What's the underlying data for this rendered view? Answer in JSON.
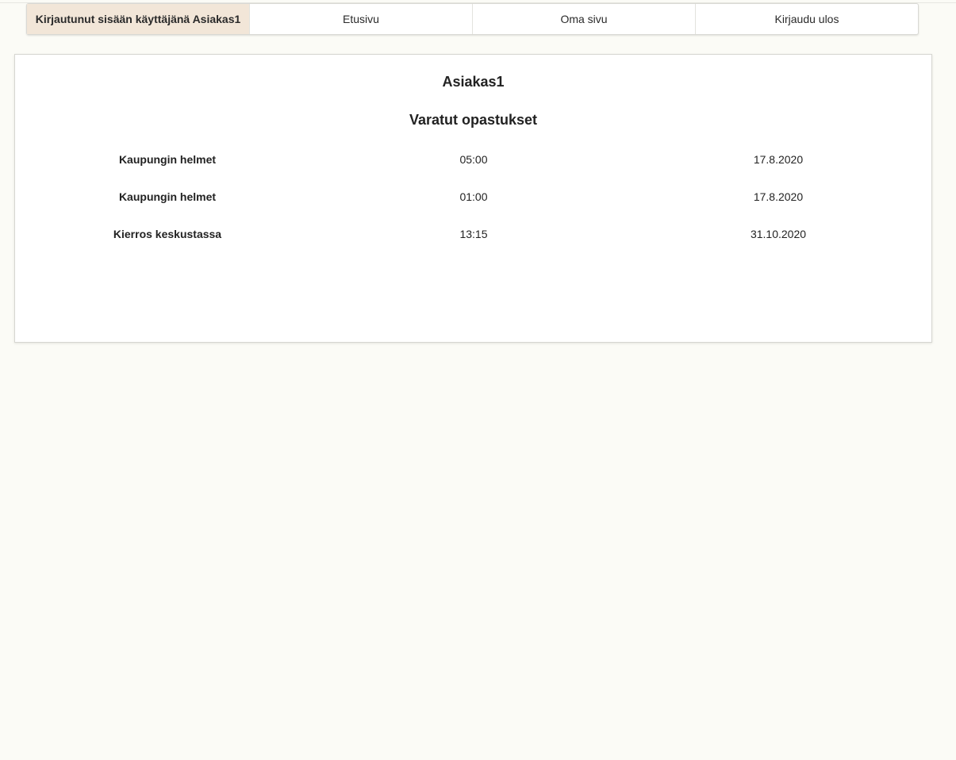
{
  "navbar": {
    "logged_in_label": "Kirjautunut sisään käyttäjänä Asiakas1",
    "home_label": "Etusivu",
    "my_page_label": "Oma sivu",
    "logout_label": "Kirjaudu ulos"
  },
  "profile": {
    "username": "Asiakas1",
    "section_title": "Varatut opastukset"
  },
  "bookings": [
    {
      "name": "Kaupungin helmet",
      "time": "05:00",
      "date": "17.8.2020"
    },
    {
      "name": "Kaupungin helmet",
      "time": "01:00",
      "date": "17.8.2020"
    },
    {
      "name": "Kierros keskustassa",
      "time": "13:15",
      "date": "31.10.2020"
    }
  ]
}
